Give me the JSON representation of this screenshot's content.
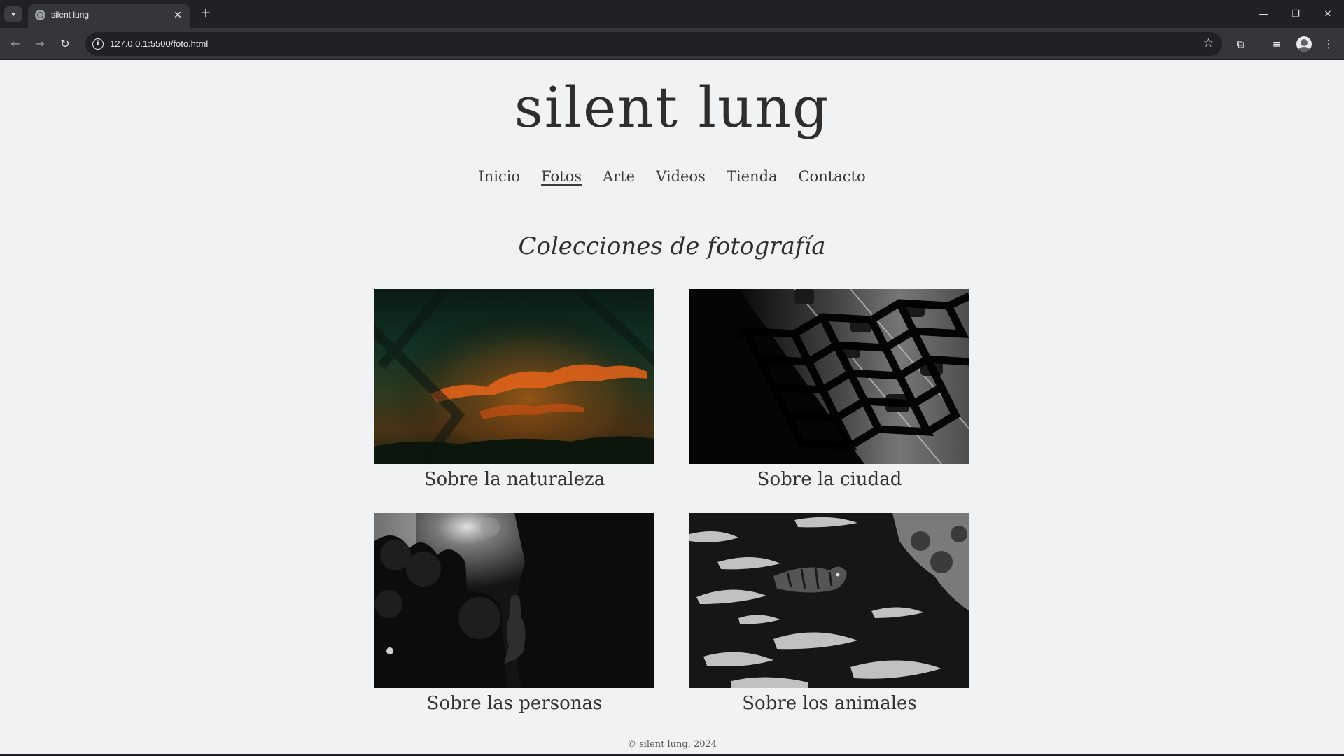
{
  "browser": {
    "tab_title": "silent lung",
    "url": "127.0.0.1:5500/foto.html",
    "icons": {
      "tab_list": "chevron-down-icon",
      "favicon": "globe-icon",
      "close": "close-icon",
      "new_tab": "plus-icon",
      "back": "arrow-left-icon",
      "forward": "arrow-right-icon",
      "reload": "reload-icon",
      "site_info": "info-icon",
      "bookmark": "star-icon",
      "extensions": "puzzle-icon",
      "media": "media-control-icon",
      "profile": "avatar-icon",
      "menu": "kebab-menu-icon"
    }
  },
  "site": {
    "title": "silent lung",
    "nav": [
      "Inicio",
      "Fotos",
      "Arte",
      "Videos",
      "Tienda",
      "Contacto"
    ],
    "current_nav": "Fotos",
    "section_title": "Colecciones de fotografía",
    "collections": [
      {
        "caption": "Sobre la naturaleza",
        "photo": "sunset sky seen through chain-link fence (color)"
      },
      {
        "caption": "Sobre la ciudad",
        "photo": "highway traffic through hexagonal fence (black and white)"
      },
      {
        "caption": "Sobre las personas",
        "photo": "silhouette of person in forest (black and white)"
      },
      {
        "caption": "Sobre los animales",
        "photo": "tiger swimming in rippled water (black and white)"
      }
    ],
    "footer": "© silent lung, 2024"
  },
  "colors": {
    "page_bg": "#f1f2f3",
    "text": "#2e2e2e",
    "chrome_dark": "#202124",
    "chrome_toolbar": "#35363a"
  }
}
